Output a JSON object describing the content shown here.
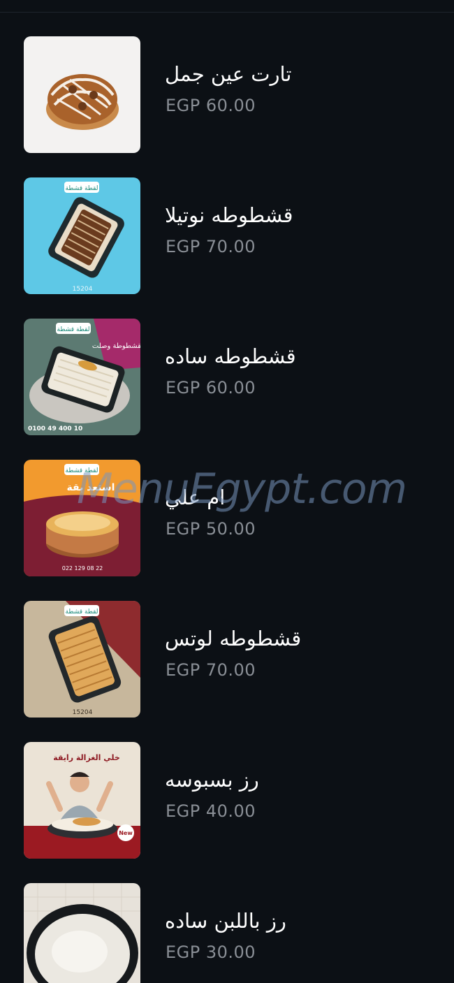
{
  "menu": {
    "items": [
      {
        "name": "تارت عين جمل",
        "price": "EGP 60.00"
      },
      {
        "name": "قشطوطه نوتيلا",
        "price": "EGP 70.00"
      },
      {
        "name": "قشطوطه ساده",
        "price": "EGP 60.00"
      },
      {
        "name": "ام علي",
        "price": "EGP 50.00"
      },
      {
        "name": "قشطوطه لوتس",
        "price": "EGP 70.00"
      },
      {
        "name": "رز بسبوسه",
        "price": "EGP 40.00"
      },
      {
        "name": "رز باللبن ساده",
        "price": "EGP 30.00"
      }
    ]
  },
  "thumbs": {
    "item2_code": "15204",
    "item3_phone": "0100 49 400 10",
    "item3_headline": "القشطوطة وصلت!",
    "item4_headline": "استعد بقة",
    "item4_phone": "022 129 08 22",
    "item5_code": "15204",
    "item6_headline": "خلي الغزالة رايقة",
    "item6_badge": "New",
    "brand_logo": "لقطة قشطة"
  },
  "watermark": {
    "text": "MenuEgypt.com"
  },
  "colors": {
    "background": "#0c1015",
    "title": "#ffffff",
    "price": "#8a8f96"
  }
}
